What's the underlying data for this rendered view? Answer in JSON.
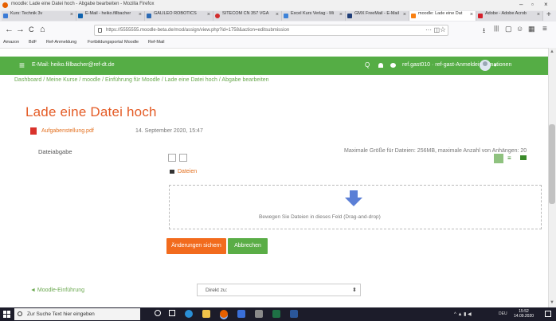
{
  "window": {
    "title": "moodle: Lade eine Datei hoch - Abgabe bearbeiten - Mozilla Firefox",
    "controls": [
      "–",
      "▫",
      "×"
    ]
  },
  "tabs": [
    {
      "label": "Kurs: Technik 3v",
      "color": "#3b7bd6"
    },
    {
      "label": "E-Mail - heiko.fillbacher",
      "color": "#0f62ae"
    },
    {
      "label": "GALILEO ROBOTICS",
      "color": "#2c6bb5"
    },
    {
      "label": "SITECOM CN 357 VGA",
      "color": "#d22c2c"
    },
    {
      "label": "Excel Kurs Verlag - Mi",
      "color": "#3d82d8"
    },
    {
      "label": "GMX FreeMail - E-Mail",
      "color": "#1f3e78"
    },
    {
      "label": "moodle: Lade eine Dat",
      "color": "#f98012",
      "active": true
    },
    {
      "label": "Adobe - Adobe Acrob",
      "color": "#d41f2a"
    }
  ],
  "nav": {
    "url": "https://5555555.moodle-beta.de/mod/assign/view.php?id=1758&action=editsubmission",
    "back": "←",
    "forward": "→",
    "reload": "C",
    "home": "⌂",
    "menu_dots": "···",
    "right_icons": [
      "⭳",
      "|||",
      "▢",
      "☺",
      "▦",
      "≡"
    ]
  },
  "bookmarks": [
    "Amazon",
    "BdF",
    "Ref-Anmeldung",
    "Fortbildungsportal",
    "Moodle",
    "Ref-Mail"
  ],
  "moodle_header": {
    "menu_icon": "≡",
    "mail_text": "E-Mail: heiko.fillbacher@ref-dt.de",
    "user_text": "ref.gast010 · ref-gast-Anmeldeinformationen",
    "search_icon": "Q",
    "bell_icon": "🔔",
    "chat_icon": "💬"
  },
  "breadcrumb": [
    "Dashboard",
    "Meine Kurse",
    "moodle",
    "Einführung für Moodle",
    "Lade eine Datei hoch",
    "Abgabe bearbeiten"
  ],
  "page_title": "Lade eine Datei hoch",
  "attachment": {
    "name": "Aufgabenstellung.pdf",
    "date": "14. September 2020, 15:47"
  },
  "submission": {
    "label": "Dateiabgabe",
    "limits": "Maximale Größe für Dateien: 256MB, maximale Anzahl von Anhängen: 20",
    "folder_label": "Dateien",
    "drop_text": "Bewegen Sie Dateien in dieses Feld (Drag-and-drop)"
  },
  "buttons": {
    "save": "Änderungen sichern",
    "cancel": "Abbrechen"
  },
  "footer": {
    "prev_link": "◄ Moodle-Einführung",
    "jump_to": "Direkt zu:",
    "chevron": "⬍"
  },
  "taskbar": {
    "search_placeholder": "Zur Suche Text hier eingeben",
    "time": "15:52",
    "date": "14.09.2020",
    "lang": "DEU"
  },
  "colors": {
    "accent": "#e45b25",
    "moodle_green": "#55ad45",
    "save_btn": "#f26b1d",
    "cancel_btn": "#5aad46"
  }
}
